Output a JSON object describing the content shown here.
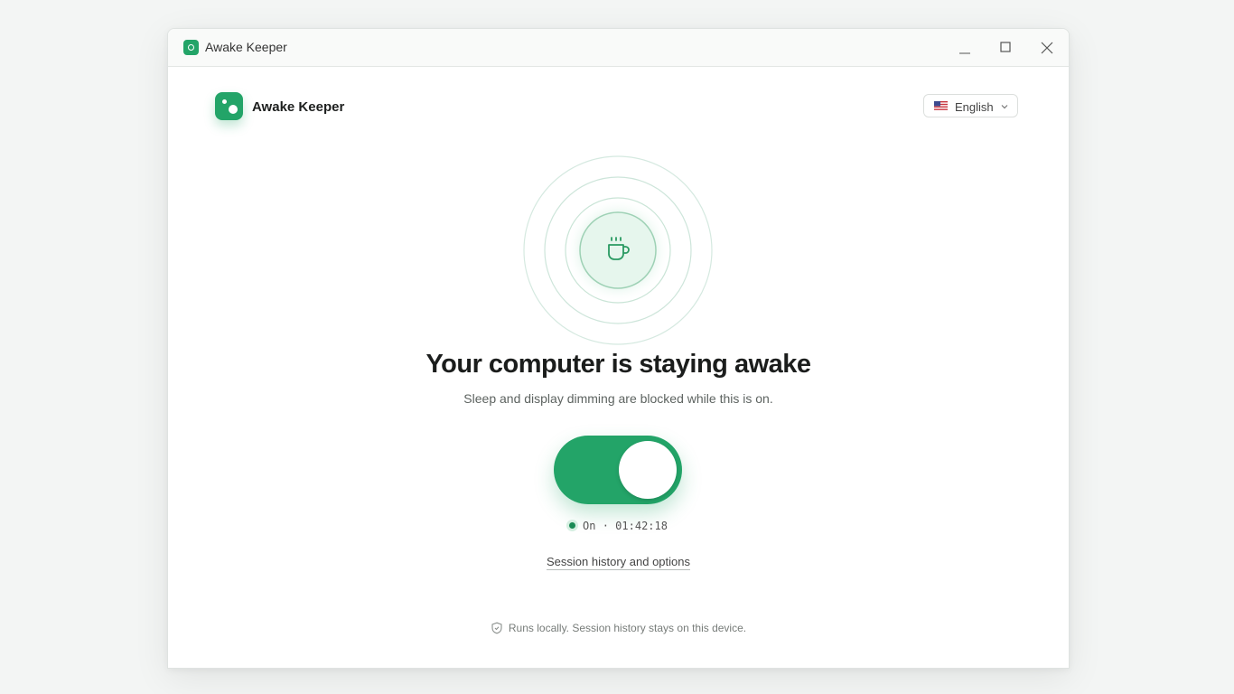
{
  "window": {
    "title": "Awake Keeper"
  },
  "header": {
    "app_name": "Awake Keeper",
    "language": "English",
    "flag_icon": "us-flag-icon"
  },
  "main": {
    "headline": "Your computer is staying awake",
    "subline": "Sleep and display dimming are blocked while this is on.",
    "toggle_state": "on",
    "status_label": "On",
    "status_separator": "·",
    "elapsed": "01:42:18",
    "history_link": "Session history and options"
  },
  "footer": {
    "note": "Runs locally. Session history stays on this device."
  },
  "colors": {
    "accent": "#23a468",
    "accent_dark": "#1a8a55",
    "ring": "#cfe6dc",
    "halo": "#e2f5eb"
  }
}
